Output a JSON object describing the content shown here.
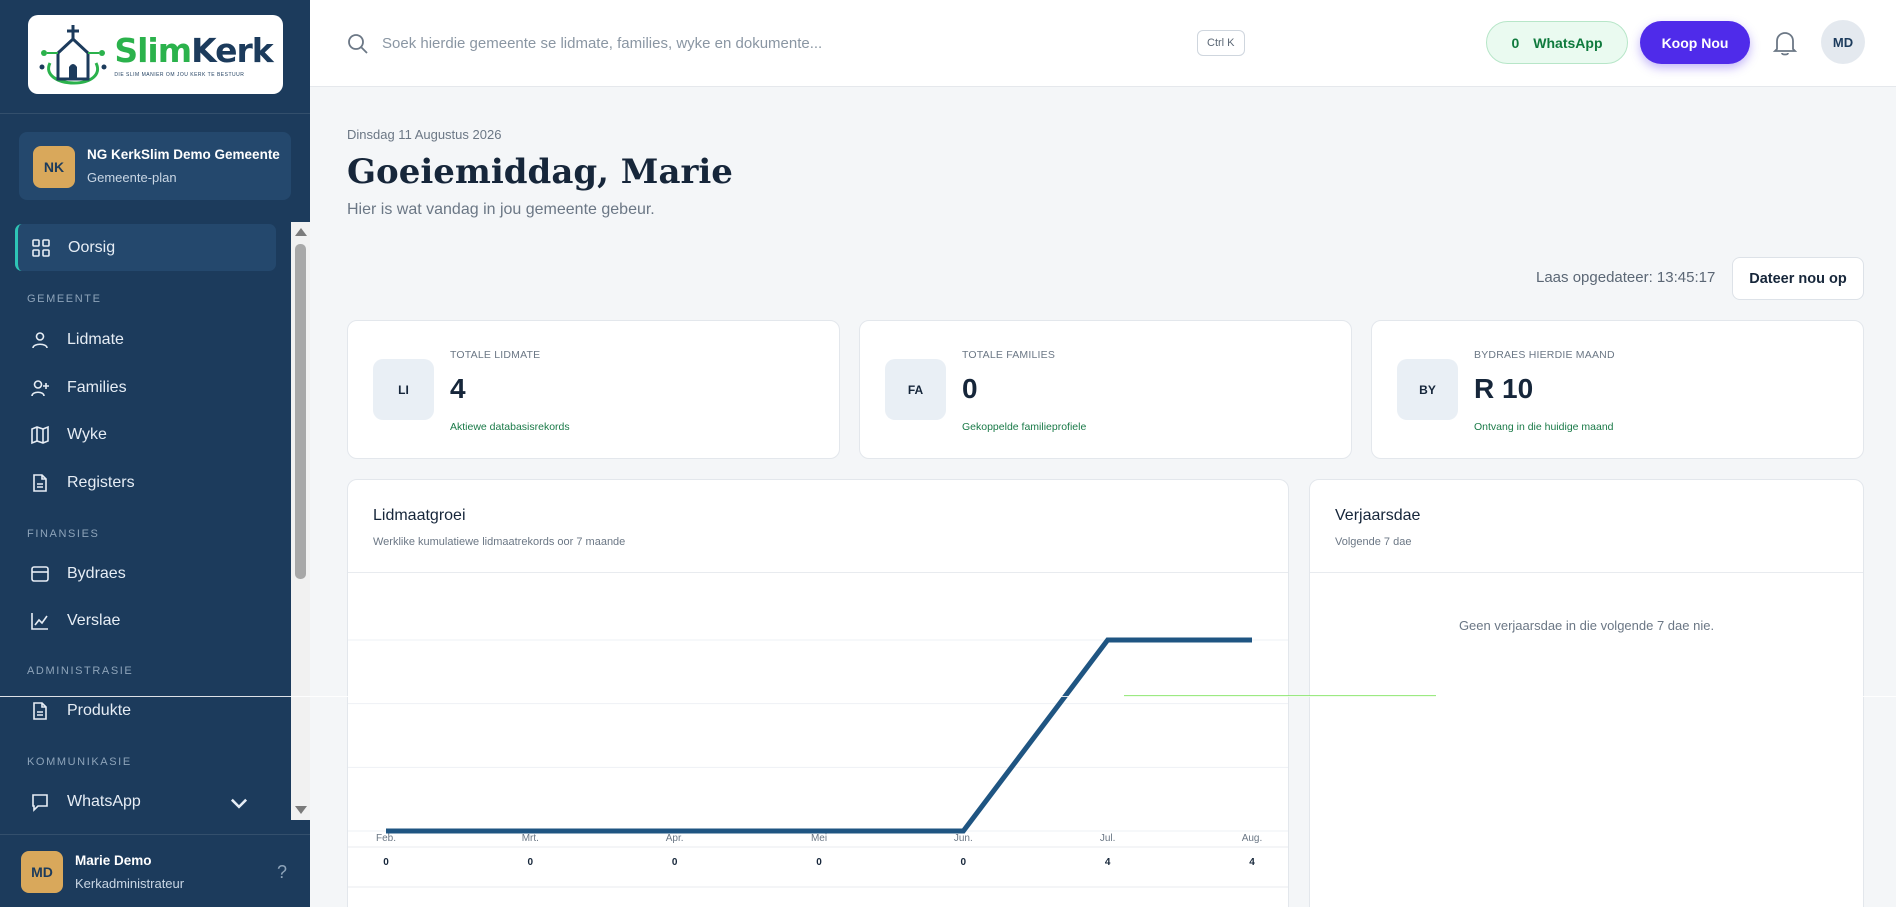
{
  "brand": {
    "slim": "Slim",
    "kerk": "Kerk",
    "tagline": "DIE SLIM MANIER OM JOU KERK TE BESTUUR"
  },
  "church": {
    "initials": "NK",
    "name": "NG KerkSlim Demo Gemeente",
    "plan": "Gemeente-plan"
  },
  "sidebar": {
    "items": [
      {
        "label": "Oorsig",
        "icon": "grid-icon"
      },
      {
        "section": "GEMEENTE"
      },
      {
        "label": "Lidmate",
        "icon": "user-icon"
      },
      {
        "label": "Families",
        "icon": "user-plus-icon"
      },
      {
        "label": "Wyke",
        "icon": "map-icon"
      },
      {
        "label": "Registers",
        "icon": "document-icon"
      },
      {
        "section": "FINANSIES"
      },
      {
        "label": "Bydraes",
        "icon": "wallet-icon"
      },
      {
        "label": "Verslae",
        "icon": "line-chart-icon"
      },
      {
        "section": "ADMINISTRASIE"
      },
      {
        "label": "Produkte",
        "icon": "document-icon"
      },
      {
        "section": "KOMMUNIKASIE"
      },
      {
        "label": "WhatsApp",
        "icon": "chat-icon"
      }
    ]
  },
  "user": {
    "initials": "MD",
    "name": "Marie Demo",
    "role": "Kerkadministrateur",
    "help": "?"
  },
  "topbar": {
    "search_placeholder": "Soek hierdie gemeente se lidmate, families, wyke en dokumente...",
    "shortcut": "Ctrl K",
    "whatsapp_count": "0",
    "whatsapp_label": "WhatsApp",
    "buy_label": "Koop Nou",
    "avatar_initials": "MD"
  },
  "header": {
    "date": "Dinsdag 11 Augustus 2026",
    "greeting": "Goeiemiddag, Marie",
    "subtitle": "Hier is wat vandag in jou gemeente gebeur.",
    "last_updated": "Laas opgedateer: 13:45:17",
    "refresh_label": "Dateer nou op"
  },
  "stats": [
    {
      "badge": "LI",
      "label": "TOTALE LIDMATE",
      "value": "4",
      "sub": "Aktiewe databasisrekords"
    },
    {
      "badge": "FA",
      "label": "TOTALE FAMILIES",
      "value": "0",
      "sub": "Gekoppelde familieprofiele"
    },
    {
      "badge": "BY",
      "label": "BYDRAES HIERDIE MAAND",
      "value": "R 10",
      "sub": "Ontvang in die huidige maand"
    }
  ],
  "growth": {
    "title": "Lidmaatgroei",
    "subtitle": "Werklike kumulatiewe lidmaatrekords oor 7 maande"
  },
  "birthdays": {
    "title": "Verjaarsdae",
    "subtitle": "Volgende 7 dae",
    "empty": "Geen verjaarsdae in die volgende 7 dae nie."
  },
  "colors": {
    "sidebar": "#1c3b5c",
    "accent": "#4f2bea",
    "line": "#1f5582",
    "positive": "#1a7a48"
  },
  "chart_data": {
    "type": "line",
    "categories": [
      "Feb.",
      "Mrt.",
      "Apr.",
      "Mei",
      "Jun.",
      "Jul.",
      "Aug."
    ],
    "values": [
      0,
      0,
      0,
      0,
      0,
      4,
      4
    ],
    "title": "Lidmaatgroei",
    "ylim": [
      0,
      4
    ],
    "grid": true
  }
}
